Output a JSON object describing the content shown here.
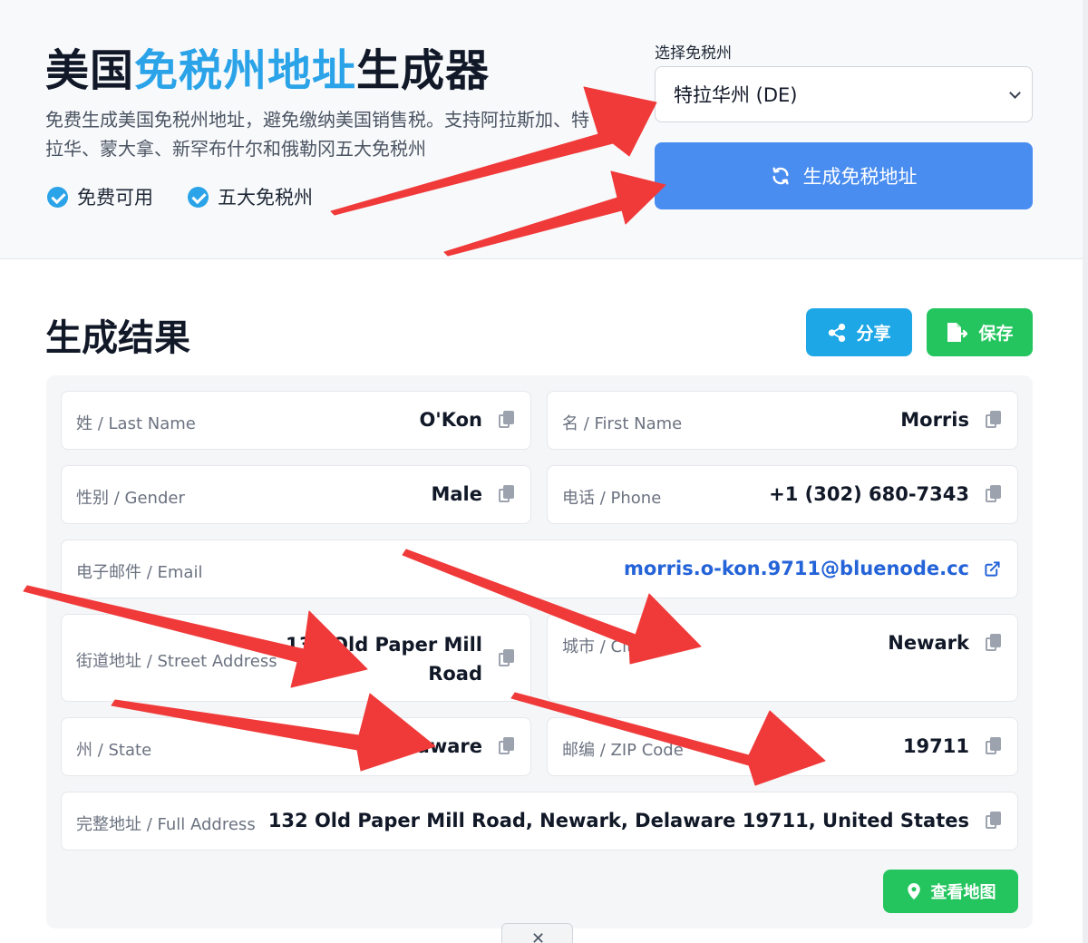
{
  "hero": {
    "title_part1": "美国",
    "title_accent": "免税州地址",
    "title_part2": "生成器",
    "description": "免费生成美国免税州地址，避免缴纳美国销售税。支持阿拉斯加、特拉华、蒙大拿、新罕布什尔和俄勒冈五大免税州",
    "features": [
      "免费可用",
      "五大免税州"
    ],
    "accent_color": "#2aa3e8"
  },
  "state_selector": {
    "label": "选择免税州",
    "selected": "特拉华州 (DE)"
  },
  "generate_button": {
    "label": "生成免税地址",
    "icon": "refresh-icon",
    "color": "#4a8df0"
  },
  "results": {
    "title": "生成结果",
    "share_label": "分享",
    "save_label": "保存",
    "map_label": "查看地图",
    "fields": {
      "last_name": {
        "label": "姓 / Last Name",
        "value": "O'Kon"
      },
      "first_name": {
        "label": "名 / First Name",
        "value": "Morris"
      },
      "gender": {
        "label": "性别 / Gender",
        "value": "Male"
      },
      "phone": {
        "label": "电话 / Phone",
        "value": "+1 (302) 680-7343"
      },
      "email": {
        "label": "电子邮件 / Email",
        "value": "morris.o-kon.9711@bluenode.cc"
      },
      "street": {
        "label": "街道地址 / Street Address",
        "value": "132 Old Paper Mill Road"
      },
      "city": {
        "label": "城市 / City",
        "value": "Newark"
      },
      "state": {
        "label": "州 / State",
        "value": "Delaware"
      },
      "zip": {
        "label": "邮编 / ZIP Code",
        "value": "19711"
      },
      "full": {
        "label": "完整地址 / Full Address",
        "value": "132 Old Paper Mill Road, Newark, Delaware 19711, United States"
      }
    }
  },
  "bottom_tab_icon": "close-icon",
  "annotation_color": "#f03a3a"
}
